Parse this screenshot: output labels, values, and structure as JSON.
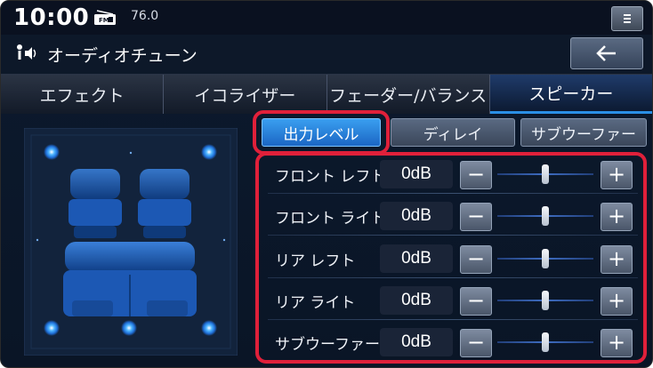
{
  "status": {
    "time": "10:00",
    "frequency": "76.0",
    "radio_icon": "fm-radio-icon",
    "menu_icon": "menu-icon"
  },
  "titlebar": {
    "title": "オーディオチューン",
    "icon": "audio-tune-icon",
    "back_icon": "back-arrow-icon"
  },
  "tabs": [
    {
      "label": "エフェクト",
      "active": false
    },
    {
      "label": "イコライザー",
      "active": false
    },
    {
      "label": "フェーダー/バランス",
      "active": false
    },
    {
      "label": "スピーカー",
      "active": true
    }
  ],
  "subtabs": [
    {
      "label": "出力レベル",
      "active": true
    },
    {
      "label": "ディレイ",
      "active": false
    },
    {
      "label": "サブウーファー",
      "active": false
    }
  ],
  "rows": [
    {
      "label": "フロント レフト",
      "value": "0dB",
      "level": 0.5
    },
    {
      "label": "フロント ライト",
      "value": "0dB",
      "level": 0.5
    },
    {
      "label": "リア レフト",
      "value": "0dB",
      "level": 0.5
    },
    {
      "label": "リア ライト",
      "value": "0dB",
      "level": 0.5
    },
    {
      "label": "サブウーファー",
      "value": "0dB",
      "level": 0.5
    }
  ],
  "controls": {
    "minus": "−",
    "plus": "+"
  },
  "colors": {
    "accent": "#2a8fe6",
    "highlight": "#e0203a",
    "background": "#0c1a2e"
  }
}
